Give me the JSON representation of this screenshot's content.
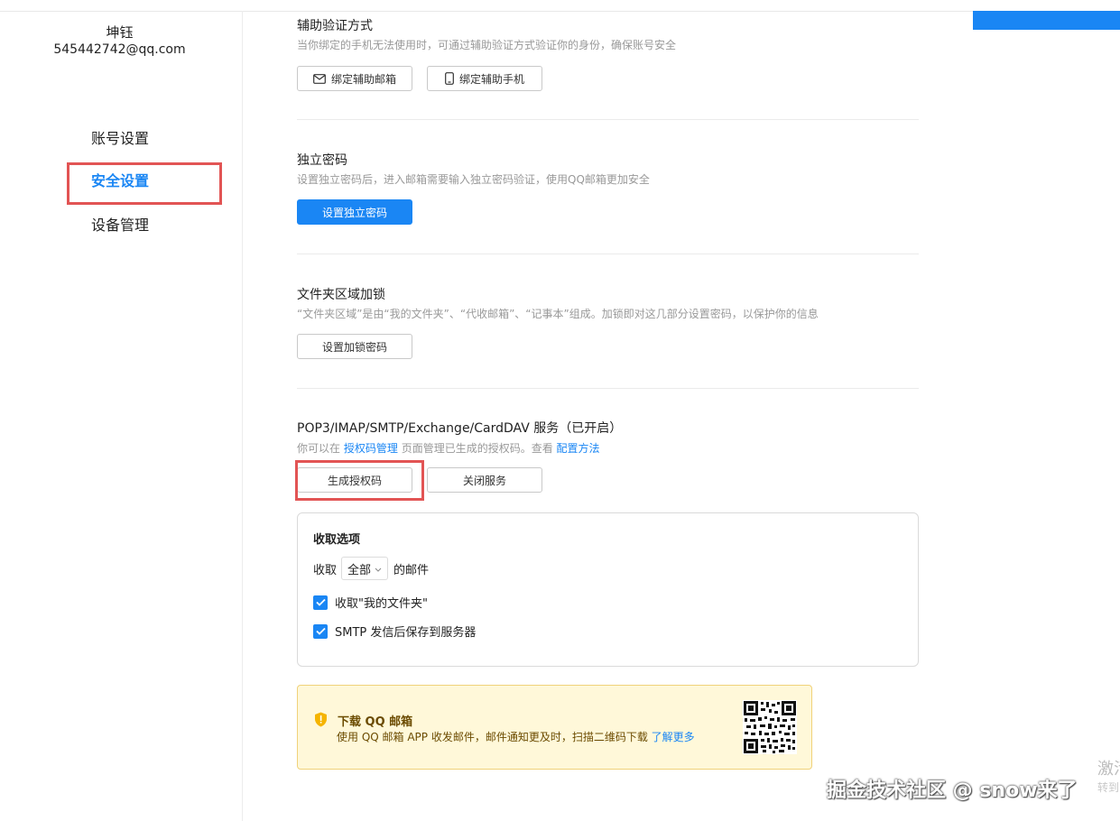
{
  "user": {
    "name": "坤钰",
    "email": "545442742@qq.com"
  },
  "nav": {
    "items": [
      {
        "label": "账号设置"
      },
      {
        "label": "安全设置"
      },
      {
        "label": "设备管理"
      }
    ],
    "active": "安全设置"
  },
  "sections": {
    "aux_verify": {
      "title": "辅助验证方式",
      "desc": "当你绑定的手机无法使用时，可通过辅助验证方式验证你的身份，确保账号安全",
      "btn_email": "绑定辅助邮箱",
      "btn_phone": "绑定辅助手机"
    },
    "independent_pwd": {
      "title": "独立密码",
      "desc": "设置独立密码后，进入邮箱需要输入独立密码验证，使用QQ邮箱更加安全",
      "btn": "设置独立密码"
    },
    "folder_lock": {
      "title": "文件夹区域加锁",
      "desc": "“文件夹区域”是由“我的文件夹”、“代收邮箱”、“记事本”组成。加锁即对这几部分设置密码，以保护你的信息",
      "btn": "设置加锁密码"
    },
    "pop3": {
      "title": "POP3/IMAP/SMTP/Exchange/CardDAV 服务（已开启）",
      "desc_prefix": "你可以在",
      "desc_link1": "授权码管理",
      "desc_mid": "页面管理已生成的授权码。查看",
      "desc_link2": "配置方法",
      "btn_generate": "生成授权码",
      "btn_close": "关闭服务"
    }
  },
  "receive_options": {
    "title": "收取选项",
    "prefix": "收取",
    "select_value": "全部",
    "suffix": "的邮件",
    "check1": "收取\"我的文件夹\"",
    "check2": "SMTP 发信后保存到服务器"
  },
  "promo": {
    "title": "下载 QQ 邮箱",
    "desc": "使用 QQ 邮箱 APP 收发邮件，邮件通知更及时，扫描二维码下载",
    "link": "了解更多"
  },
  "watermark": "掘金技术社区 @ snow来了",
  "activate": {
    "title": "激活",
    "sub": "转到"
  },
  "colors": {
    "accent": "#1a86f4",
    "highlight_box": "#e25454",
    "promo_bg": "#fff8d9"
  }
}
